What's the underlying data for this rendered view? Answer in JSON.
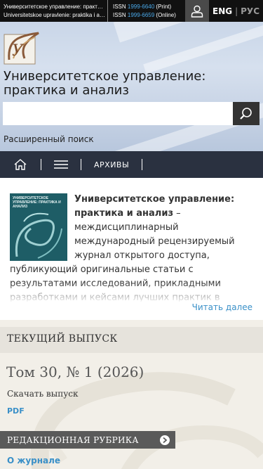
{
  "topbar": {
    "title_ru": "Университетское управление: практика и анализ",
    "title_en": "Universitetskoe upravlenie: praktika i analiz",
    "issn_label": "ISSN",
    "issn_print": "1999-6640",
    "issn_print_suffix": "(Print)",
    "issn_online": "1999-6659",
    "issn_online_suffix": "(Online)",
    "lang_en": "ENG",
    "lang_sep": "|",
    "lang_ru": "РУС"
  },
  "header": {
    "journal_title": "Университетское управление: практика и анализ",
    "search_placeholder": "",
    "advanced_search": "Расширенный поиск"
  },
  "nav": {
    "archives": "АРХИВЫ"
  },
  "intro": {
    "cover_title": "УНИВЕРСИТЕТСКОЕ УПРАВЛЕНИЕ: ПРАКТИКА И АНАЛИЗ",
    "lead_bold": "Университетское управление: практика и анализ",
    "lead_text": " – междисциплинарный международный рецензируемый журнал открытого доступа, публикующий оригинальные статьи с результатами исследований, прикладными разработками и кейсами лучших практик в области организации управления",
    "read_more": "Читать далее"
  },
  "current_issue": {
    "heading": "ТЕКУЩИЙ ВЫПУСК",
    "issue_title": "Том 30, № 1 (2026)",
    "download_label": "Скачать выпуск",
    "pdf_label": "PDF",
    "rubric_label": "РЕДАКЦИОННАЯ РУБРИКА",
    "about_link": "О журнале"
  },
  "colors": {
    "topbar_bg": "#111111",
    "nav_bg": "#2a3140",
    "link": "#3a90c8",
    "accent_issn": "#4aa8e8"
  }
}
